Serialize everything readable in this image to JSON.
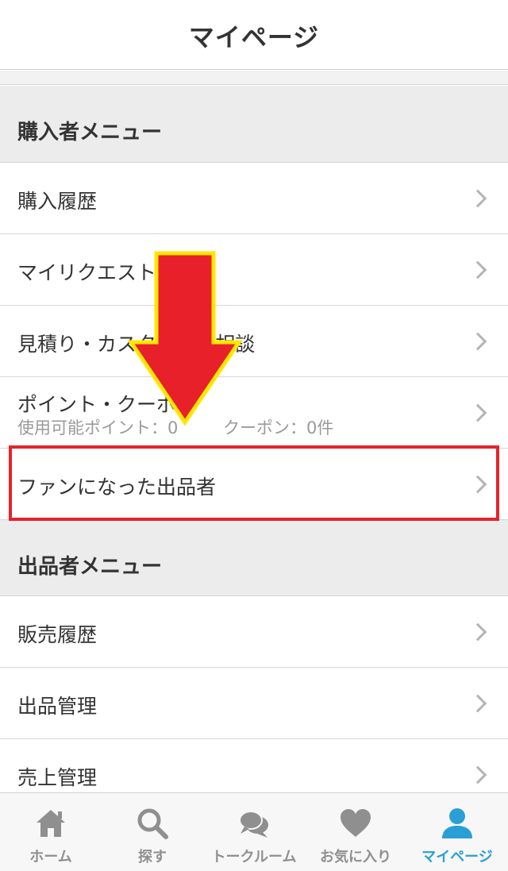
{
  "header": {
    "title": "マイページ"
  },
  "buyer_menu": {
    "title": "購入者メニュー",
    "items": [
      {
        "label": "購入履歴"
      },
      {
        "label": "マイリクエスト"
      },
      {
        "label": "見積り・カスタマイズ相談"
      },
      {
        "label": "ポイント・クーポン",
        "points": "使用可能ポイント：0",
        "coupons": "クーポン：0件"
      },
      {
        "label": "ファンになった出品者"
      }
    ]
  },
  "seller_menu": {
    "title": "出品者メニュー",
    "items": [
      {
        "label": "販売履歴"
      },
      {
        "label": "出品管理"
      },
      {
        "label": "売上管理"
      }
    ]
  },
  "tabbar": {
    "items": [
      {
        "label": "ホーム",
        "icon": "home-icon"
      },
      {
        "label": "探す",
        "icon": "search-icon"
      },
      {
        "label": "トークルーム",
        "icon": "chat-bubbles-icon"
      },
      {
        "label": "お気に入り",
        "icon": "heart-icon"
      },
      {
        "label": "マイページ",
        "icon": "person-icon"
      }
    ],
    "active_index": 4,
    "active_color": "#2a9fd6",
    "inactive_color": "#8f8f8f"
  },
  "annotations": {
    "arrow_color": "#e8202a",
    "arrow_outline": "#ffe600",
    "highlight_color": "#e3242b"
  }
}
